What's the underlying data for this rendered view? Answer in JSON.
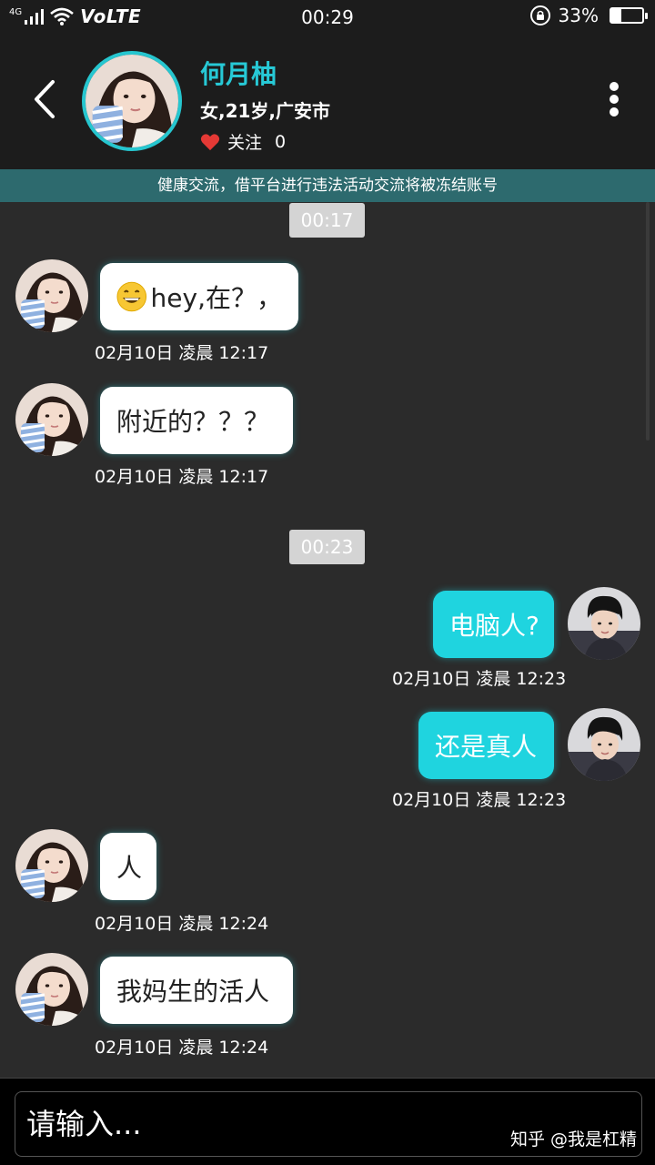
{
  "status_bar": {
    "network": "4G",
    "volte": "VoLTE",
    "time": "00:29",
    "battery_percent": "33%",
    "battery_level": 0.33
  },
  "header": {
    "name": "何月柚",
    "info": "女,21岁,广安市",
    "follow_label": "关注",
    "follow_count": "0"
  },
  "notice": "健康交流，借平台进行违法活动交流将被冻结账号",
  "time_separators": [
    "00:17",
    "00:23"
  ],
  "messages": [
    {
      "side": "in",
      "text": "hey,在？，",
      "emoji": "grinning-face",
      "time": "02月10日 凌晨 12:17"
    },
    {
      "side": "in",
      "text": "附近的？？？",
      "time": "02月10日 凌晨 12:17"
    },
    {
      "side": "out",
      "text": "电脑人?",
      "time": "02月10日 凌晨 12:23"
    },
    {
      "side": "out",
      "text": "还是真人",
      "time": "02月10日 凌晨 12:23"
    },
    {
      "side": "in",
      "text": "人",
      "time": "02月10日 凌晨 12:24"
    },
    {
      "side": "in",
      "text": "我妈生的活人",
      "time": "02月10日 凌晨 12:24"
    }
  ],
  "input": {
    "placeholder": "请输入..."
  },
  "watermark": "知乎 @我是杠精",
  "colors": {
    "accent": "#27c9d6",
    "notice_bg": "#2d6a6e",
    "outgoing_bubble": "#1fd4df",
    "heart": "#e53935"
  }
}
